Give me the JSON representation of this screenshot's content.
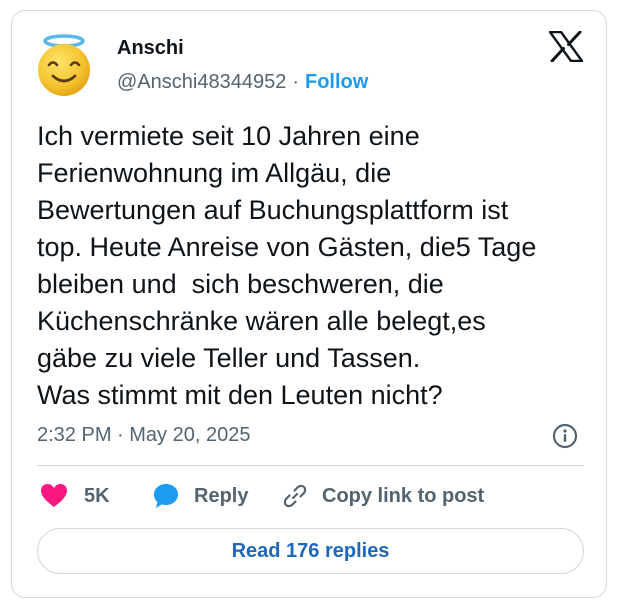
{
  "tweet": {
    "author": {
      "name": "Anschi",
      "handle": "@Anschi48344952",
      "separator": "·",
      "follow_label": "Follow"
    },
    "text": "Ich vermiete seit 10 Jahren eine\nFerienwohnung im Allgäu, die\nBewertungen auf Buchungsplattform ist\ntop. Heute Anreise von Gästen, die5 Tage\nbleiben und  sich beschweren, die\nKüchenschränke wären alle belegt,es\ngäbe zu viele Teller und Tassen.\nWas stimmt mit den Leuten nicht?",
    "timestamp": "2:32 PM · May 20, 2025"
  },
  "actions": {
    "like_count": "5K",
    "reply_label": "Reply",
    "copy_label": "Copy link to post"
  },
  "read_replies_label": "Read 176 replies",
  "icons": {
    "avatar": "smiling-face-with-halo-emoji",
    "brand": "x-logo-icon",
    "info": "info-icon",
    "like": "heart-icon",
    "reply": "speech-bubble-icon",
    "copy": "link-icon"
  },
  "colors": {
    "accent": "#1d9bf0",
    "like": "#f91880",
    "reply": "#1d9bf0",
    "text": "#0f1419",
    "muted": "#536471",
    "border": "#cfd9de"
  }
}
